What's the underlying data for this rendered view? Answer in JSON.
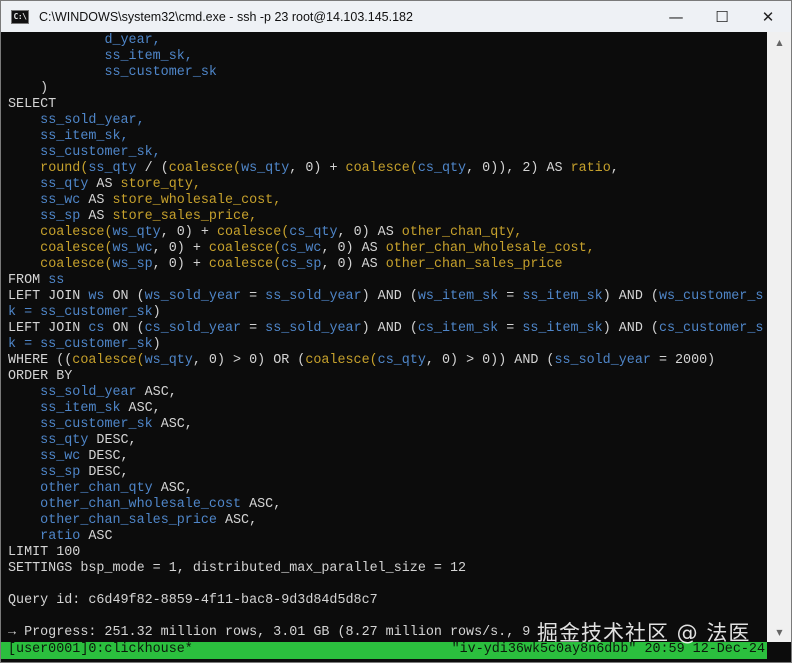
{
  "window": {
    "icon_text": "C:\\",
    "title": "C:\\WINDOWS\\system32\\cmd.exe - ssh  -p 23 root@14.103.145.182",
    "minimize_glyph": "—",
    "maximize_glyph": "☐",
    "close_glyph": "✕"
  },
  "terminal": {
    "lines": [
      [
        {
          "t": "            ",
          "c": "k"
        },
        {
          "t": "d_year,",
          "c": "i"
        }
      ],
      [
        {
          "t": "            ",
          "c": "k"
        },
        {
          "t": "ss_item_sk,",
          "c": "i"
        }
      ],
      [
        {
          "t": "            ",
          "c": "k"
        },
        {
          "t": "ss_customer_sk",
          "c": "i"
        }
      ],
      [
        {
          "t": "    )",
          "c": "k"
        }
      ],
      [
        {
          "t": "SELECT",
          "c": "k"
        }
      ],
      [
        {
          "t": "    ",
          "c": "k"
        },
        {
          "t": "ss_sold_year,",
          "c": "i"
        }
      ],
      [
        {
          "t": "    ",
          "c": "k"
        },
        {
          "t": "ss_item_sk,",
          "c": "i"
        }
      ],
      [
        {
          "t": "    ",
          "c": "k"
        },
        {
          "t": "ss_customer_sk,",
          "c": "i"
        }
      ],
      [
        {
          "t": "    ",
          "c": "k"
        },
        {
          "t": "round(",
          "c": "f"
        },
        {
          "t": "ss_qty",
          "c": "i"
        },
        {
          "t": " / (",
          "c": "k"
        },
        {
          "t": "coalesce(",
          "c": "f"
        },
        {
          "t": "ws_qty",
          "c": "i"
        },
        {
          "t": ", 0) + ",
          "c": "k"
        },
        {
          "t": "coalesce(",
          "c": "f"
        },
        {
          "t": "cs_qty",
          "c": "i"
        },
        {
          "t": ", 0)), 2) AS ",
          "c": "k"
        },
        {
          "t": "ratio",
          "c": "f"
        },
        {
          "t": ",",
          "c": "k"
        }
      ],
      [
        {
          "t": "    ",
          "c": "k"
        },
        {
          "t": "ss_qty",
          "c": "i"
        },
        {
          "t": " AS ",
          "c": "k"
        },
        {
          "t": "store_qty,",
          "c": "f"
        }
      ],
      [
        {
          "t": "    ",
          "c": "k"
        },
        {
          "t": "ss_wc",
          "c": "i"
        },
        {
          "t": " AS ",
          "c": "k"
        },
        {
          "t": "store_wholesale_cost,",
          "c": "f"
        }
      ],
      [
        {
          "t": "    ",
          "c": "k"
        },
        {
          "t": "ss_sp",
          "c": "i"
        },
        {
          "t": " AS ",
          "c": "k"
        },
        {
          "t": "store_sales_price,",
          "c": "f"
        }
      ],
      [
        {
          "t": "    ",
          "c": "k"
        },
        {
          "t": "coalesce(",
          "c": "f"
        },
        {
          "t": "ws_qty",
          "c": "i"
        },
        {
          "t": ", 0) + ",
          "c": "k"
        },
        {
          "t": "coalesce(",
          "c": "f"
        },
        {
          "t": "cs_qty",
          "c": "i"
        },
        {
          "t": ", 0) AS ",
          "c": "k"
        },
        {
          "t": "other_chan_qty,",
          "c": "f"
        }
      ],
      [
        {
          "t": "    ",
          "c": "k"
        },
        {
          "t": "coalesce(",
          "c": "f"
        },
        {
          "t": "ws_wc",
          "c": "i"
        },
        {
          "t": ", 0) + ",
          "c": "k"
        },
        {
          "t": "coalesce(",
          "c": "f"
        },
        {
          "t": "cs_wc",
          "c": "i"
        },
        {
          "t": ", 0) AS ",
          "c": "k"
        },
        {
          "t": "other_chan_wholesale_cost,",
          "c": "f"
        }
      ],
      [
        {
          "t": "    ",
          "c": "k"
        },
        {
          "t": "coalesce(",
          "c": "f"
        },
        {
          "t": "ws_sp",
          "c": "i"
        },
        {
          "t": ", 0) + ",
          "c": "k"
        },
        {
          "t": "coalesce(",
          "c": "f"
        },
        {
          "t": "cs_sp",
          "c": "i"
        },
        {
          "t": ", 0) AS ",
          "c": "k"
        },
        {
          "t": "other_chan_sales_price",
          "c": "f"
        }
      ],
      [
        {
          "t": "FROM ",
          "c": "k"
        },
        {
          "t": "ss",
          "c": "i"
        }
      ],
      [
        {
          "t": "LEFT JOIN ",
          "c": "k"
        },
        {
          "t": "ws",
          "c": "i"
        },
        {
          "t": " ON (",
          "c": "k"
        },
        {
          "t": "ws_sold_year",
          "c": "i"
        },
        {
          "t": " = ",
          "c": "k"
        },
        {
          "t": "ss_sold_year",
          "c": "i"
        },
        {
          "t": ") AND (",
          "c": "k"
        },
        {
          "t": "ws_item_sk",
          "c": "i"
        },
        {
          "t": " = ",
          "c": "k"
        },
        {
          "t": "ss_item_sk",
          "c": "i"
        },
        {
          "t": ") AND (",
          "c": "k"
        },
        {
          "t": "ws_customer_s",
          "c": "i"
        }
      ],
      [
        {
          "t": "k = ss_customer_sk",
          "c": "i"
        },
        {
          "t": ")",
          "c": "k"
        }
      ],
      [
        {
          "t": "LEFT JOIN ",
          "c": "k"
        },
        {
          "t": "cs",
          "c": "i"
        },
        {
          "t": " ON (",
          "c": "k"
        },
        {
          "t": "cs_sold_year",
          "c": "i"
        },
        {
          "t": " = ",
          "c": "k"
        },
        {
          "t": "ss_sold_year",
          "c": "i"
        },
        {
          "t": ") AND (",
          "c": "k"
        },
        {
          "t": "cs_item_sk",
          "c": "i"
        },
        {
          "t": " = ",
          "c": "k"
        },
        {
          "t": "ss_item_sk",
          "c": "i"
        },
        {
          "t": ") AND (",
          "c": "k"
        },
        {
          "t": "cs_customer_s",
          "c": "i"
        }
      ],
      [
        {
          "t": "k = ss_customer_sk",
          "c": "i"
        },
        {
          "t": ")",
          "c": "k"
        }
      ],
      [
        {
          "t": "WHERE ((",
          "c": "k"
        },
        {
          "t": "coalesce(",
          "c": "f"
        },
        {
          "t": "ws_qty",
          "c": "i"
        },
        {
          "t": ", 0) > 0) OR (",
          "c": "k"
        },
        {
          "t": "coalesce(",
          "c": "f"
        },
        {
          "t": "cs_qty",
          "c": "i"
        },
        {
          "t": ", 0) > 0)) AND (",
          "c": "k"
        },
        {
          "t": "ss_sold_year",
          "c": "i"
        },
        {
          "t": " = 2000)",
          "c": "k"
        }
      ],
      [
        {
          "t": "ORDER BY",
          "c": "k"
        }
      ],
      [
        {
          "t": "    ",
          "c": "k"
        },
        {
          "t": "ss_sold_year",
          "c": "i"
        },
        {
          "t": " ASC,",
          "c": "k"
        }
      ],
      [
        {
          "t": "    ",
          "c": "k"
        },
        {
          "t": "ss_item_sk",
          "c": "i"
        },
        {
          "t": " ASC,",
          "c": "k"
        }
      ],
      [
        {
          "t": "    ",
          "c": "k"
        },
        {
          "t": "ss_customer_sk",
          "c": "i"
        },
        {
          "t": " ASC,",
          "c": "k"
        }
      ],
      [
        {
          "t": "    ",
          "c": "k"
        },
        {
          "t": "ss_qty",
          "c": "i"
        },
        {
          "t": " DESC,",
          "c": "k"
        }
      ],
      [
        {
          "t": "    ",
          "c": "k"
        },
        {
          "t": "ss_wc",
          "c": "i"
        },
        {
          "t": " DESC,",
          "c": "k"
        }
      ],
      [
        {
          "t": "    ",
          "c": "k"
        },
        {
          "t": "ss_sp",
          "c": "i"
        },
        {
          "t": " DESC,",
          "c": "k"
        }
      ],
      [
        {
          "t": "    ",
          "c": "k"
        },
        {
          "t": "other_chan_qty",
          "c": "i"
        },
        {
          "t": " ASC,",
          "c": "k"
        }
      ],
      [
        {
          "t": "    ",
          "c": "k"
        },
        {
          "t": "other_chan_wholesale_cost",
          "c": "i"
        },
        {
          "t": " ASC,",
          "c": "k"
        }
      ],
      [
        {
          "t": "    ",
          "c": "k"
        },
        {
          "t": "other_chan_sales_price",
          "c": "i"
        },
        {
          "t": " ASC,",
          "c": "k"
        }
      ],
      [
        {
          "t": "    ",
          "c": "k"
        },
        {
          "t": "ratio",
          "c": "i"
        },
        {
          "t": " ASC",
          "c": "k"
        }
      ],
      [
        {
          "t": "LIMIT 100",
          "c": "k"
        }
      ],
      [
        {
          "t": "SETTINGS bsp_mode = 1, distributed_max_parallel_size = 12",
          "c": "k"
        }
      ],
      [],
      [
        {
          "t": "Query id: c6d49f82-8859-4f11-bac8-9d3d84d5d8c7",
          "c": "k"
        }
      ],
      [],
      [
        {
          "t": "→ Progress: 251.32 million rows, 3.01 GB (8.27 million rows/s., 9",
          "c": "k"
        }
      ]
    ]
  },
  "statusbar": {
    "left": "[user0001]0:clickhouse*",
    "right": "\"iv-ydi36wk5c0ay8n6dbb\" 20:59 12-Dec-24"
  },
  "watermark": "掘金技术社区 @ 法医",
  "scrollbar": {
    "up_glyph": "▲",
    "down_glyph": "▼"
  },
  "colors": {
    "background": "#0c0c0c",
    "keyword": "#d4d4d4",
    "identifier": "#4f86c9",
    "function_alias": "#c6a12c",
    "status_bar": "#2bbf3e"
  }
}
